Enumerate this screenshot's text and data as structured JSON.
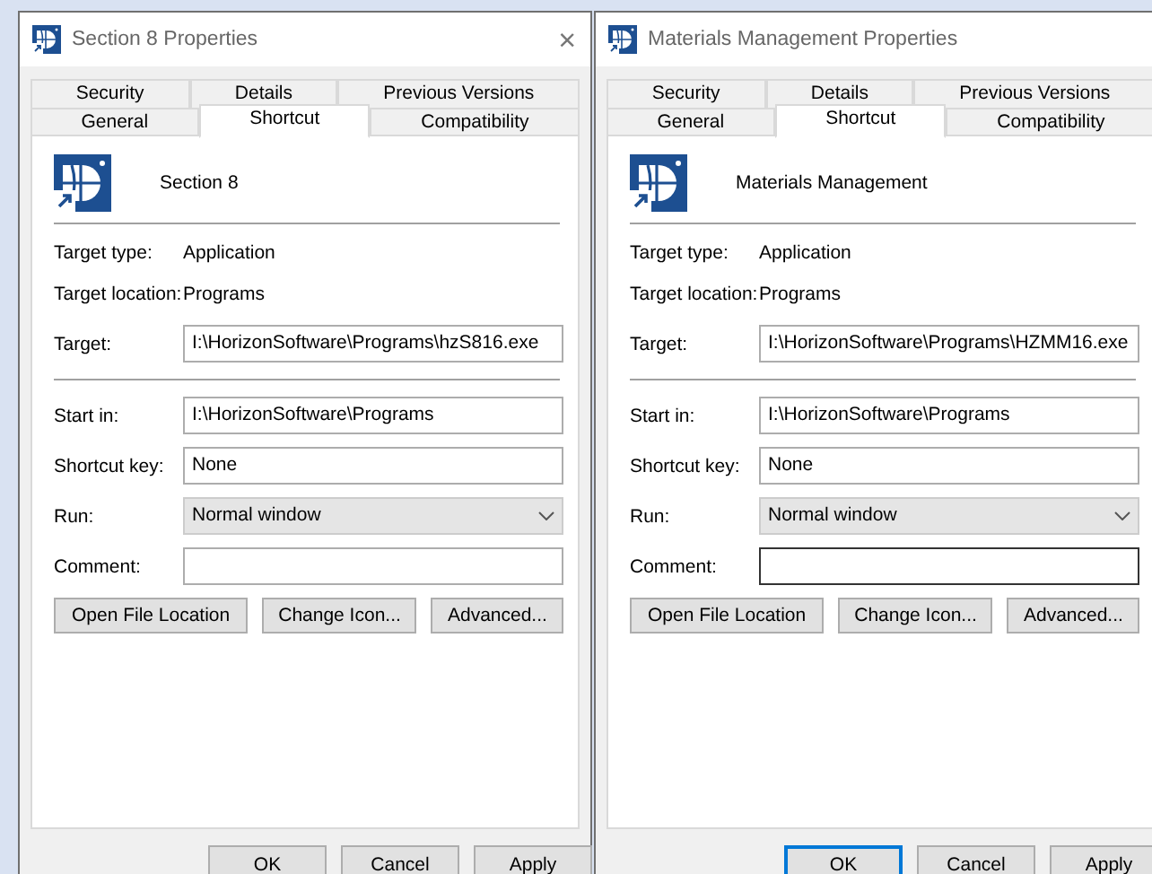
{
  "windows": [
    {
      "title": "Section 8 Properties",
      "close": "×",
      "tab_rows": [
        [
          {
            "label": "Security",
            "selected": false
          },
          {
            "label": "Details",
            "selected": false
          },
          {
            "label": "Previous Versions",
            "selected": false
          }
        ],
        [
          {
            "label": "General",
            "selected": false
          },
          {
            "label": "Shortcut",
            "selected": true
          },
          {
            "label": "Compatibility",
            "selected": false
          }
        ]
      ],
      "name": "Section 8",
      "info": [
        {
          "label": "Target type:",
          "value": "Application"
        },
        {
          "label": "Target location:",
          "value": "Programs"
        }
      ],
      "target": {
        "label": "Target:",
        "value": "I:\\HorizonSoftware\\Programs\\hzS816.exe",
        "focused": false
      },
      "fields": [
        {
          "kind": "text",
          "label": "Start in:",
          "value": "I:\\HorizonSoftware\\Programs",
          "focused": false
        },
        {
          "kind": "text",
          "label": "Shortcut key:",
          "value": "None",
          "focused": false
        },
        {
          "kind": "select",
          "label": "Run:",
          "value": "Normal window",
          "focused": false
        },
        {
          "kind": "text",
          "label": "Comment:",
          "focused": false
        }
      ],
      "actions": [
        "Open File Location",
        "Change Icon...",
        "Advanced..."
      ],
      "dialog_buttons": [
        {
          "label": "OK",
          "default": false
        },
        {
          "label": "Cancel",
          "default": false
        },
        {
          "label": "Apply",
          "default": false
        }
      ]
    },
    {
      "title": "Materials Management Properties",
      "tab_rows": [
        [
          {
            "label": "Security",
            "selected": false
          },
          {
            "label": "Details",
            "selected": false
          },
          {
            "label": "Previous Versions",
            "selected": false
          }
        ],
        [
          {
            "label": "General",
            "selected": false
          },
          {
            "label": "Shortcut",
            "selected": true
          },
          {
            "label": "Compatibility",
            "selected": false
          }
        ]
      ],
      "name": "Materials Management",
      "info": [
        {
          "label": "Target type:",
          "value": "Application"
        },
        {
          "label": "Target location:",
          "value": "Programs"
        }
      ],
      "target": {
        "label": "Target:",
        "value": "I:\\HorizonSoftware\\Programs\\HZMM16.exe",
        "focused": false
      },
      "fields": [
        {
          "kind": "text",
          "label": "Start in:",
          "value": "I:\\HorizonSoftware\\Programs",
          "focused": false
        },
        {
          "kind": "text",
          "label": "Shortcut key:",
          "value": "None",
          "focused": false
        },
        {
          "kind": "select",
          "label": "Run:",
          "value": "Normal window",
          "focused": false
        },
        {
          "kind": "text",
          "label": "Comment:",
          "focused": true
        }
      ],
      "actions": [
        "Open File Location",
        "Change Icon...",
        "Advanced..."
      ],
      "dialog_buttons": [
        {
          "label": "OK",
          "default": true
        },
        {
          "label": "Cancel",
          "default": false
        },
        {
          "label": "Apply",
          "default": false
        }
      ]
    }
  ]
}
